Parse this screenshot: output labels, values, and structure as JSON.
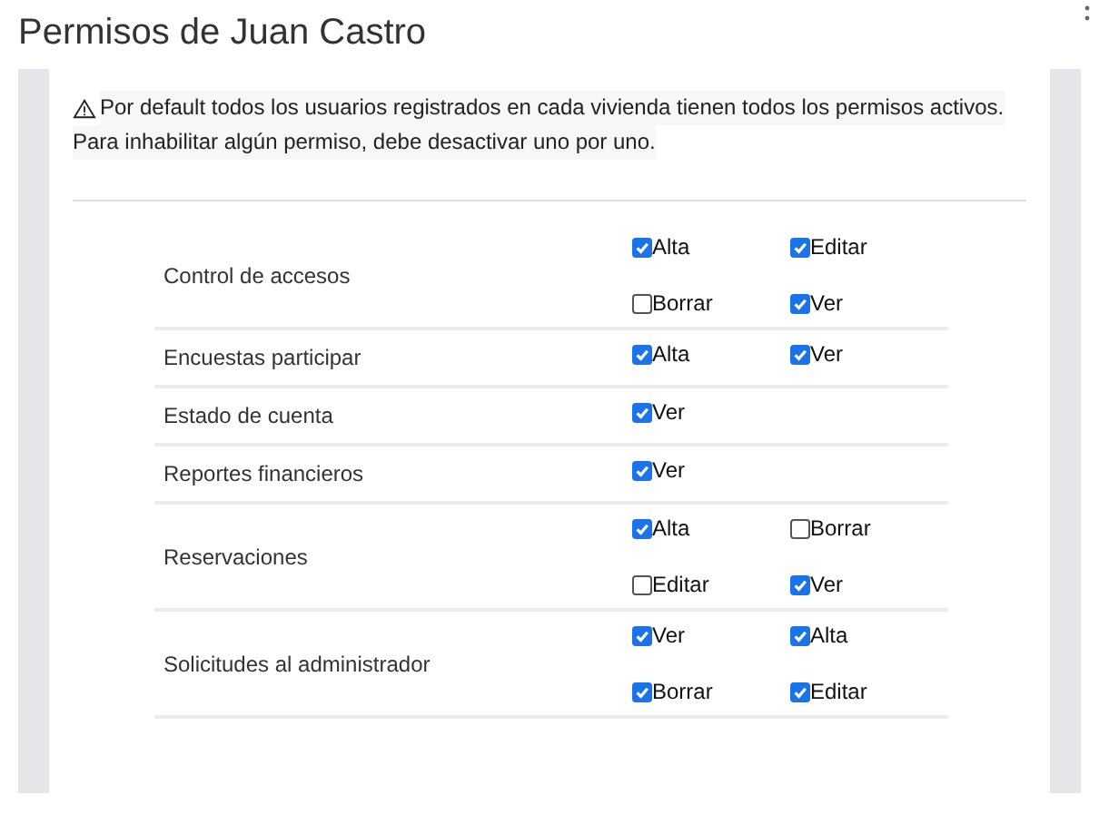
{
  "title": "Permisos de Juan Castro",
  "notice": [
    "Por default todos los usuarios registrados en cada vivienda tienen todos los permisos activos.",
    "Para inhabilitar algún permiso, debe desactivar uno por uno."
  ],
  "modules": [
    {
      "name": "Control de accesos",
      "permissions": [
        {
          "label": "Alta",
          "checked": true
        },
        {
          "label": "Editar",
          "checked": true
        },
        {
          "label": "Borrar",
          "checked": false
        },
        {
          "label": "Ver",
          "checked": true
        }
      ]
    },
    {
      "name": "Encuestas participar",
      "permissions": [
        {
          "label": "Alta",
          "checked": true
        },
        {
          "label": "Ver",
          "checked": true
        }
      ]
    },
    {
      "name": "Estado de cuenta",
      "permissions": [
        {
          "label": "Ver",
          "checked": true
        }
      ]
    },
    {
      "name": "Reportes financieros",
      "permissions": [
        {
          "label": "Ver",
          "checked": true
        }
      ]
    },
    {
      "name": "Reservaciones",
      "permissions": [
        {
          "label": "Alta",
          "checked": true
        },
        {
          "label": "Borrar",
          "checked": false
        },
        {
          "label": "Editar",
          "checked": false
        },
        {
          "label": "Ver",
          "checked": true
        }
      ]
    },
    {
      "name": "Solicitudes al administrador",
      "permissions": [
        {
          "label": "Ver",
          "checked": true
        },
        {
          "label": "Alta",
          "checked": true
        },
        {
          "label": "Borrar",
          "checked": true
        },
        {
          "label": "Editar",
          "checked": true
        }
      ]
    }
  ]
}
